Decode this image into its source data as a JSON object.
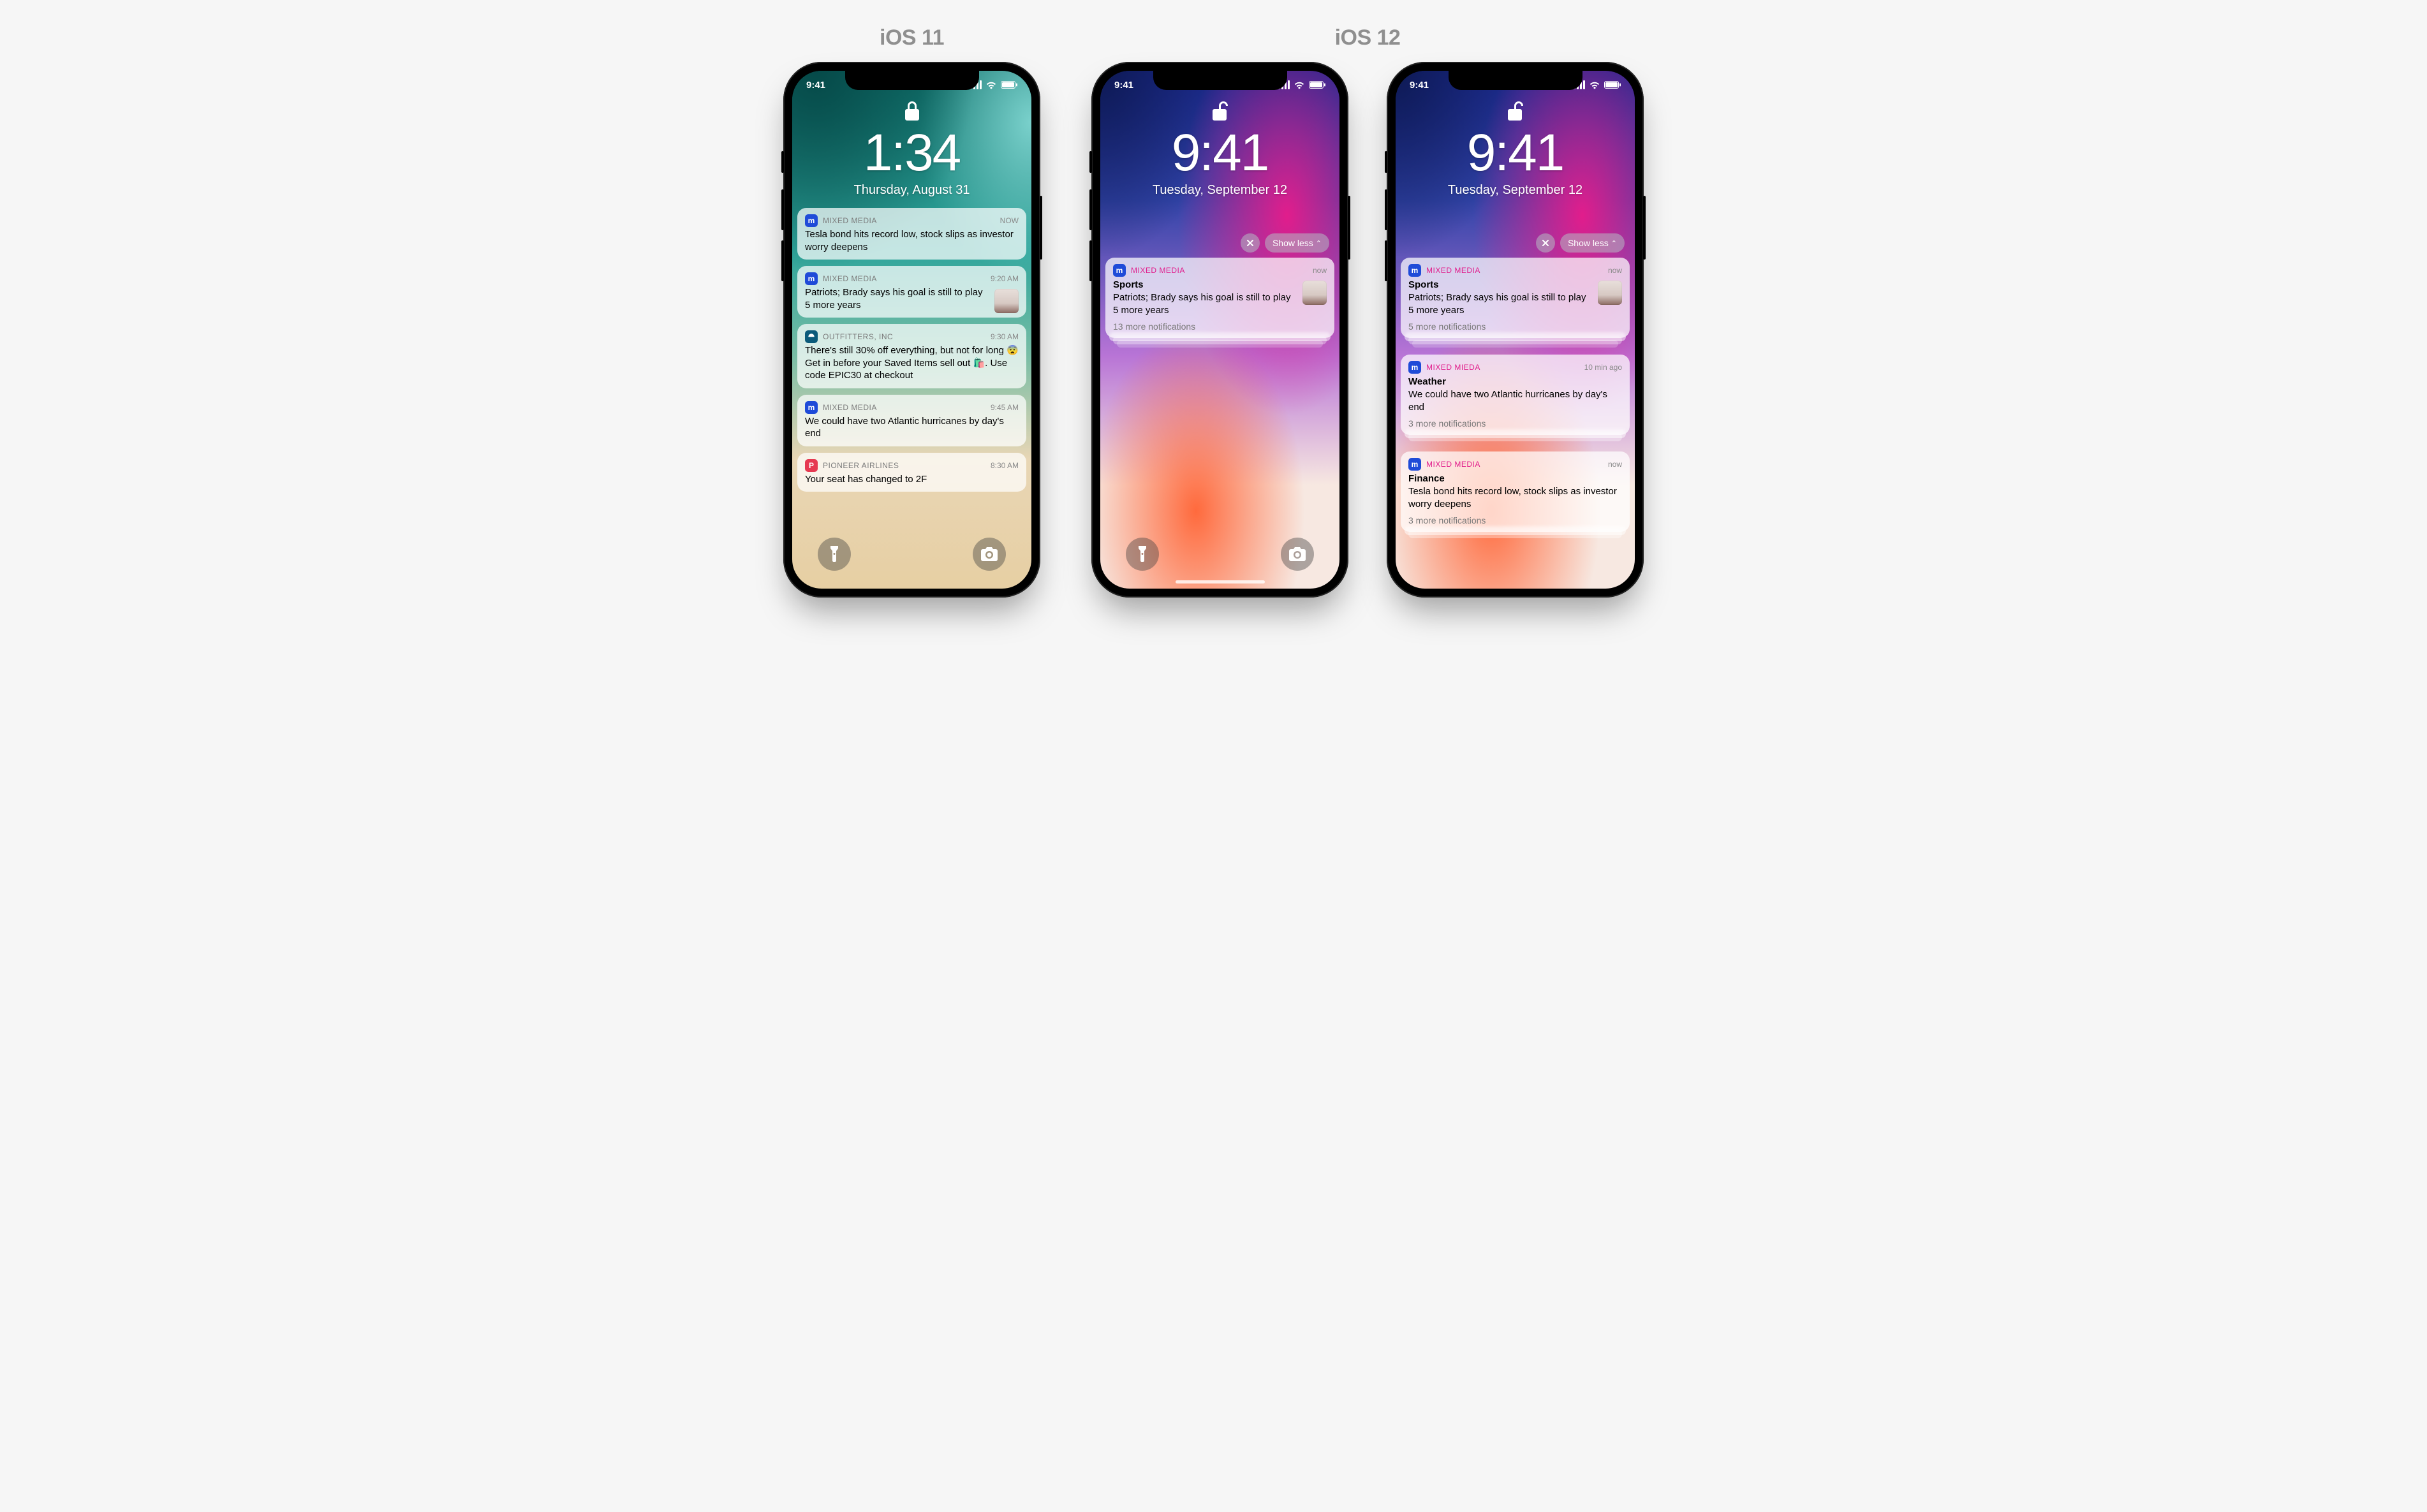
{
  "labels": {
    "ios11": "iOS 11",
    "ios12": "iOS 12"
  },
  "status_time": "9:41",
  "show_less": "Show less",
  "phone11": {
    "locked": true,
    "time": "1:34",
    "date": "Thursday, August 31",
    "notifications": [
      {
        "app": "MIXED MEDIA",
        "icon": "mixed",
        "ts": "NOW",
        "body": "Tesla bond hits record low, stock slips as investor worry deepens"
      },
      {
        "app": "MIXED MEDIA",
        "icon": "mixed",
        "ts": "9:20 AM",
        "body": "Patriots; Brady says his goal is still to play 5 more years",
        "thumb": true
      },
      {
        "app": "OUTFITTERS, INC",
        "icon": "outfit",
        "ts": "9:30 AM",
        "body": "There's still 30% off everything, but not for long 😨 Get in before your Saved Items sell out 🛍️. Use code EPIC30 at checkout"
      },
      {
        "app": "MIXED MEDIA",
        "icon": "mixed",
        "ts": "9:45 AM",
        "body": "We could have two Atlantic hurricanes by day's end"
      },
      {
        "app": "PIONEER AIRLINES",
        "icon": "pioneer",
        "ts": "8:30 AM",
        "body": "Your seat has changed to 2F"
      }
    ]
  },
  "phone12a": {
    "locked": false,
    "time": "9:41",
    "date": "Tuesday, September 12",
    "group": {
      "app": "MIXED MEDIA",
      "ts": "now",
      "title": "Sports",
      "body": "Patriots; Brady says his goal is still to play 5 more years",
      "more": "13 more notifications",
      "thumb": true
    }
  },
  "phone12b": {
    "locked": false,
    "time": "9:41",
    "date": "Tuesday, September 12",
    "groups": [
      {
        "app": "MIXED MEDIA",
        "ts": "now",
        "title": "Sports",
        "body": "Patriots; Brady says his goal is still to play 5 more years",
        "more": "5 more notifications",
        "thumb": true
      },
      {
        "app": "MIXED MIEDA",
        "ts": "10 min ago",
        "title": "Weather",
        "body": "We could have two Atlantic hurricanes by day's end",
        "more": "3 more notifications"
      },
      {
        "app": "MIXED MEDIA",
        "ts": "now",
        "title": "Finance",
        "body": "Tesla bond hits record low, stock slips as investor worry deepens",
        "more": "3 more notifications"
      }
    ]
  }
}
